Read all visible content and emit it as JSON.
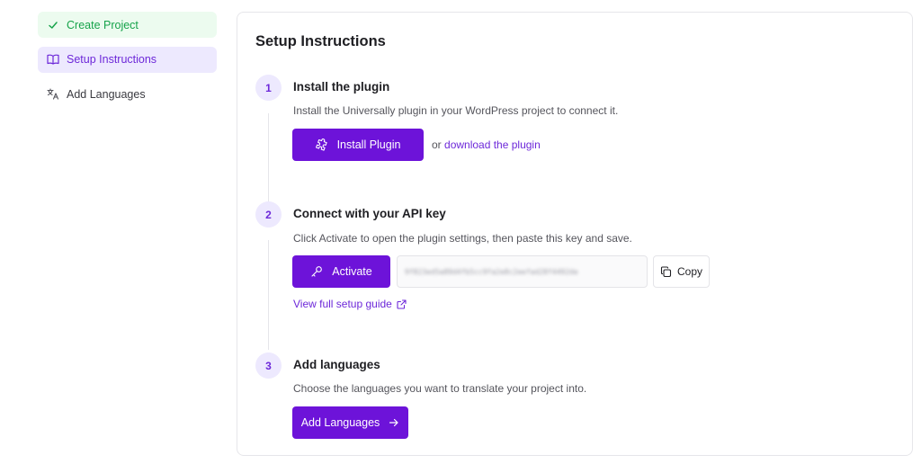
{
  "sidebar": {
    "items": [
      {
        "label": "Create Project",
        "icon": "check-icon",
        "state": "done",
        "color": "#16a34a"
      },
      {
        "label": "Setup Instructions",
        "icon": "book-open-icon",
        "state": "active",
        "color": "#6d28d9"
      },
      {
        "label": "Add Languages",
        "icon": "translate-icon",
        "state": "pending"
      }
    ]
  },
  "main": {
    "title": "Setup Instructions",
    "steps": [
      {
        "number": "1",
        "title": "Install the plugin",
        "description": "Install the Universally plugin in your WordPress project to connect it.",
        "button_label": "Install Plugin",
        "button_icon": "puzzle-icon",
        "or_text": "or",
        "link_label": "download the plugin"
      },
      {
        "number": "2",
        "title": "Connect with your API key",
        "description": "Click Activate to open the plugin settings, then paste this key and save.",
        "button_label": "Activate",
        "button_icon": "key-icon",
        "api_key_masked": "9f823ed5a89d4fb5cc9fa2e8c2eefad28f4492de",
        "copy_label": "Copy",
        "guide_link": "View full setup guide"
      },
      {
        "number": "3",
        "title": "Add languages",
        "description": "Choose the languages you want to translate your project into.",
        "button_label": "Add Languages",
        "button_icon": "arrow-right-icon"
      }
    ]
  },
  "colors": {
    "accent": "#6d13d9",
    "accent_text": "#6d28d9",
    "step_bubble": "#ede9fe",
    "success": "#16a34a",
    "success_bg": "#ecfbef"
  }
}
